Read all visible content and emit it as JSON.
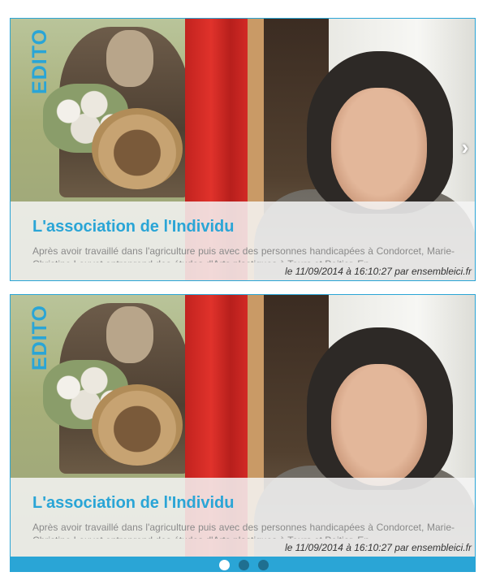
{
  "slides": [
    {
      "badge": "EDITO",
      "title": "L'association de l'Individu",
      "excerpt": "Après avoir travaillé dans l'agriculture puis avec des personnes handicapées à Condorcet, Marie-Christine Louvet entreprend des études d'Arts plastiques à Tours et Poitier. En",
      "meta": "le 11/09/2014 à 16:10:27 par ensembleici.fr"
    },
    {
      "badge": "EDITO",
      "title": "L'association de l'Individu",
      "excerpt": "Après avoir travaillé dans l'agriculture puis avec des personnes handicapées à Condorcet, Marie-Christine Louvet entreprend des études d'Arts plastiques à Tours et Poitier. En",
      "meta": "le 11/09/2014 à 16:10:27 par ensembleici.fr"
    }
  ],
  "next_arrow": "›",
  "pager": {
    "count": 3,
    "active_index": 0
  },
  "colors": {
    "accent": "#2aa5d6",
    "overlay": "#f4f4f4",
    "meta_text": "#333333"
  }
}
